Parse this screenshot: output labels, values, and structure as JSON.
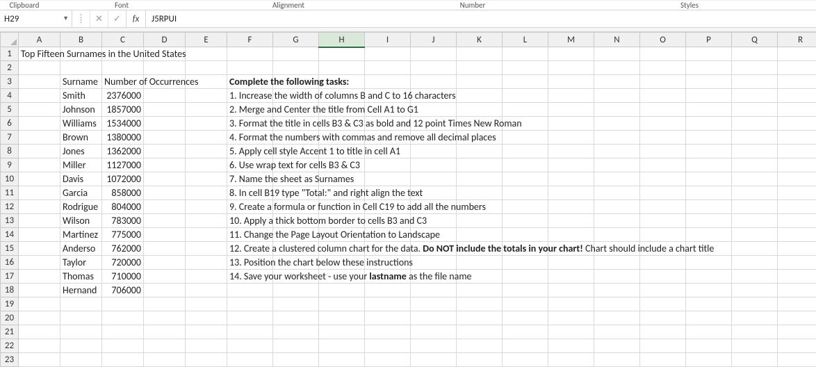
{
  "ribbon": {
    "groups": [
      "Clipboard",
      "Font",
      "Alignment",
      "Number",
      "Styles"
    ]
  },
  "formula_bar": {
    "name_box": "H29",
    "cancel_icon": "✕",
    "enter_icon": "✓",
    "fx_label": "fx",
    "formula": "J5RPUI"
  },
  "columns": [
    "A",
    "B",
    "C",
    "D",
    "E",
    "F",
    "G",
    "H",
    "I",
    "J",
    "K",
    "L",
    "M",
    "N",
    "O",
    "P",
    "Q",
    "R"
  ],
  "selected_column": "H",
  "rows_shown": 23,
  "sheet": {
    "title": "Top Fifteen Surnames in the United States",
    "header_surname": "Surname",
    "header_count": "Number of Occurrences",
    "data": [
      {
        "surname": "Smith",
        "count": "2376000"
      },
      {
        "surname": "Johnson",
        "count": "1857000"
      },
      {
        "surname": "Williams",
        "count": "1534000"
      },
      {
        "surname": "Brown",
        "count": "1380000"
      },
      {
        "surname": "Jones",
        "count": "1362000"
      },
      {
        "surname": "Miller",
        "count": "1127000"
      },
      {
        "surname": "Davis",
        "count": "1072000"
      },
      {
        "surname": "Garcia",
        "count": "858000"
      },
      {
        "surname": "Rodrigue",
        "count": "804000"
      },
      {
        "surname": "Wilson",
        "count": "783000"
      },
      {
        "surname": "Martinez",
        "count": "775000"
      },
      {
        "surname": "Anderso",
        "count": "762000"
      },
      {
        "surname": "Taylor",
        "count": "720000"
      },
      {
        "surname": "Thomas",
        "count": "710000"
      },
      {
        "surname": "Hernand",
        "count": "706000"
      }
    ],
    "tasks_header": "Complete the following tasks:",
    "tasks": [
      "1. Increase the width of columns B and C to 16 characters",
      "2. Merge and Center the title from Cell A1 to G1",
      "3. Format the title in cells  B3 & C3 as bold and 12 point Times New Roman",
      "4. Format the numbers with commas and remove all decimal places",
      "5. Apply cell style Accent 1 to title in cell A1",
      "6. Use wrap text for cells B3 & C3",
      "7. Name the sheet as Surnames",
      "8. In cell B19 type \"Total:\" and right align the text",
      "9. Create a formula or function in Cell C19 to add all the numbers",
      "10. Apply a thick bottom border to cells B3 and C3",
      "11. Change the Page Layout Orientation to Landscape",
      {
        "pre": "12. Create a clustered column chart for the data.  ",
        "bold": "Do NOT include the totals in your chart!",
        "post": "  Chart should include a chart title"
      },
      "13. Position the chart below these instructions",
      {
        "pre": "14. Save your worksheet - use your ",
        "bold": "lastname",
        "post": " as the file name"
      }
    ]
  }
}
